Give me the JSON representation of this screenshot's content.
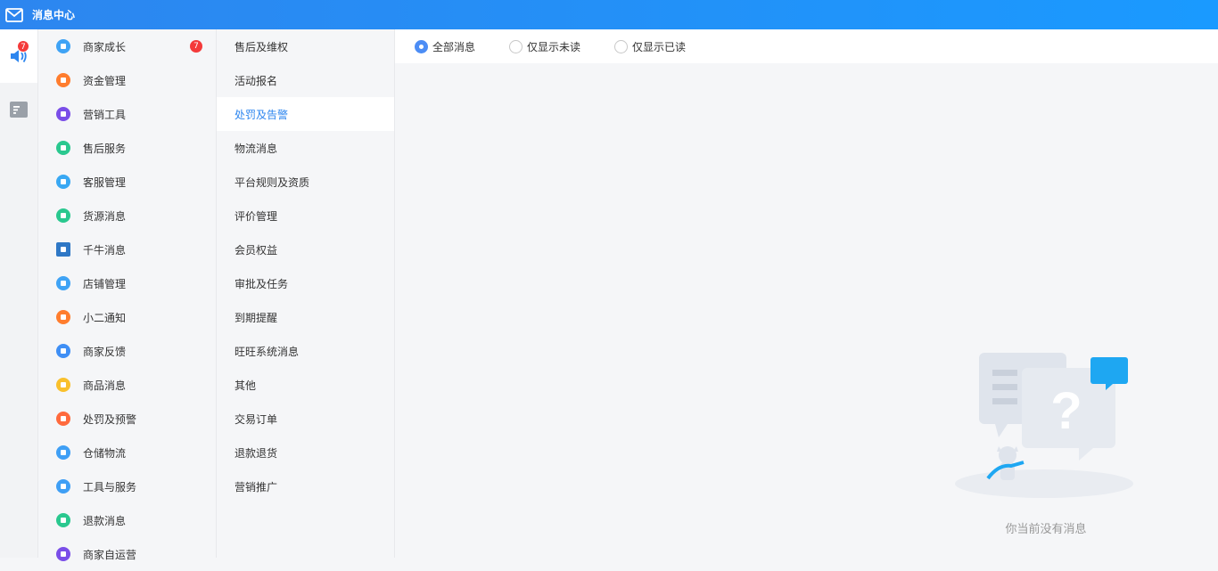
{
  "window": {
    "title": "消息中心"
  },
  "rail": {
    "items": [
      {
        "name": "speaker-icon",
        "badge": "7",
        "active": true
      },
      {
        "name": "list-doc-icon",
        "badge": "",
        "active": false
      }
    ]
  },
  "categories": [
    {
      "label": "商家成长",
      "color": "#3fa3f5",
      "badge": "7"
    },
    {
      "label": "资金管理",
      "color": "#ff7d2e",
      "badge": ""
    },
    {
      "label": "营销工具",
      "color": "#7a4ee8",
      "badge": ""
    },
    {
      "label": "售后服务",
      "color": "#2ac88f",
      "badge": ""
    },
    {
      "label": "客服管理",
      "color": "#39a8f3",
      "badge": ""
    },
    {
      "label": "货源消息",
      "color": "#2ac88f",
      "badge": ""
    },
    {
      "label": "千牛消息",
      "color": "#2f78c6",
      "badge": "",
      "square": true
    },
    {
      "label": "店铺管理",
      "color": "#3fa3f5",
      "badge": ""
    },
    {
      "label": "小二通知",
      "color": "#ff7d2e",
      "badge": ""
    },
    {
      "label": "商家反馈",
      "color": "#3f8ff5",
      "badge": ""
    },
    {
      "label": "商品消息",
      "color": "#f9c02c",
      "badge": ""
    },
    {
      "label": "处罚及预警",
      "color": "#ff6a3d",
      "badge": ""
    },
    {
      "label": "仓储物流",
      "color": "#3f9ff5",
      "badge": ""
    },
    {
      "label": "工具与服务",
      "color": "#3f9ff5",
      "badge": ""
    },
    {
      "label": "退款消息",
      "color": "#2ac88f",
      "badge": ""
    },
    {
      "label": "商家自运营",
      "color": "#7a4ee8",
      "badge": ""
    }
  ],
  "subcategories": [
    {
      "label": "售后及维权",
      "active": false
    },
    {
      "label": "活动报名",
      "active": false
    },
    {
      "label": "处罚及告警",
      "active": true
    },
    {
      "label": "物流消息",
      "active": false
    },
    {
      "label": "平台规则及资质",
      "active": false
    },
    {
      "label": "评价管理",
      "active": false
    },
    {
      "label": "会员权益",
      "active": false
    },
    {
      "label": "审批及任务",
      "active": false
    },
    {
      "label": "到期提醒",
      "active": false
    },
    {
      "label": "旺旺系统消息",
      "active": false
    },
    {
      "label": "其他",
      "active": false
    },
    {
      "label": "交易订单",
      "active": false
    },
    {
      "label": "退款退货",
      "active": false
    },
    {
      "label": "营销推广",
      "active": false
    }
  ],
  "filters": [
    {
      "label": "全部消息",
      "checked": true
    },
    {
      "label": "仅显示未读",
      "checked": false
    },
    {
      "label": "仅显示已读",
      "checked": false
    }
  ],
  "empty": {
    "text": "你当前没有消息"
  },
  "colors": {
    "accent": "#2d86ef",
    "badge": "#f43a3a"
  }
}
